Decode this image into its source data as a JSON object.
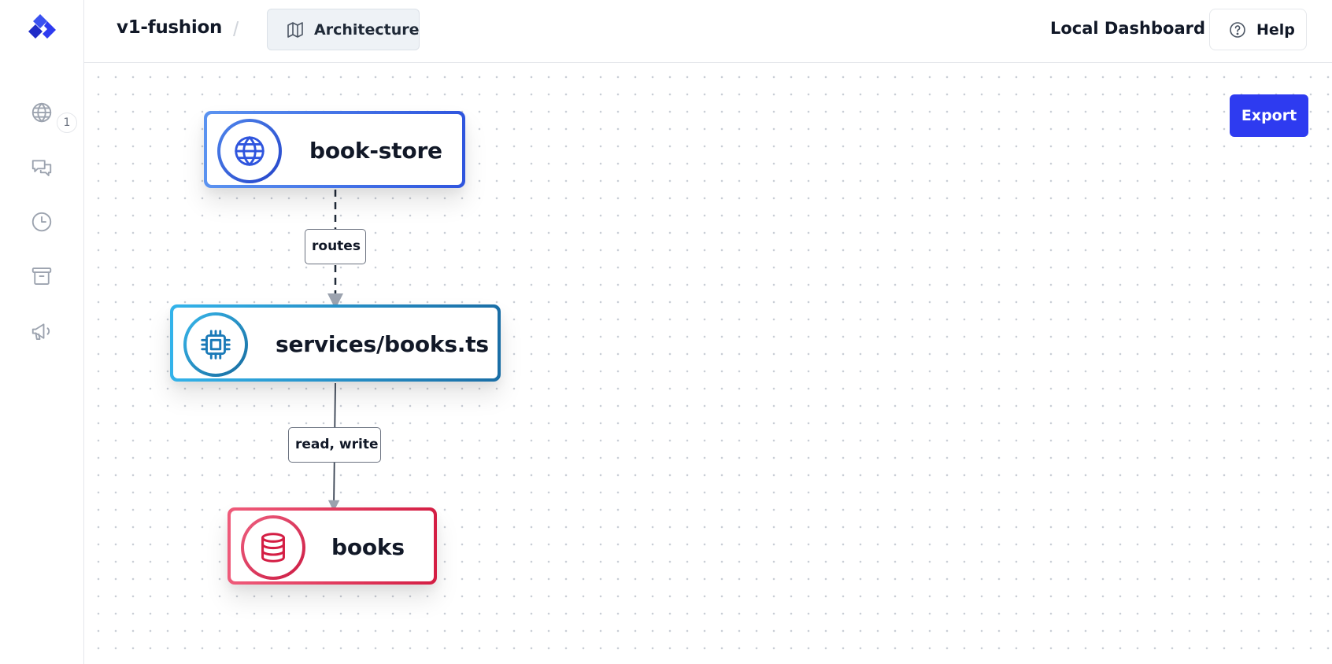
{
  "app": {
    "project_name": "v1-fushion",
    "breadcrumb_separator": "/",
    "current_view": "Architecture"
  },
  "sidebar": {
    "items": [
      {
        "name": "globe-icon",
        "badge": "1"
      },
      {
        "name": "chat-icon"
      },
      {
        "name": "clock-icon"
      },
      {
        "name": "archive-icon"
      },
      {
        "name": "megaphone-icon"
      }
    ]
  },
  "header": {
    "dashboard_link": "Local Dashboard",
    "help_label": "Help"
  },
  "canvas": {
    "export_label": "Export",
    "nodes": [
      {
        "id": "book-store",
        "label": "book-store",
        "kind": "web-app",
        "icon": "globe-icon",
        "color": "#2f55de"
      },
      {
        "id": "books-service",
        "label": "services/books.ts",
        "kind": "service",
        "icon": "chip-icon",
        "color": "#1a6ea6"
      },
      {
        "id": "books-db",
        "label": "books",
        "kind": "database",
        "icon": "database-icon",
        "color": "#d41e44"
      }
    ],
    "edges": [
      {
        "from": "book-store",
        "to": "books-service",
        "label": "routes",
        "style": "dashed"
      },
      {
        "from": "books-service",
        "to": "books-db",
        "label": "read, write",
        "style": "solid"
      }
    ]
  },
  "colors": {
    "accent": "#2e3bf0",
    "border": "#e5e7eb",
    "text": "#111827",
    "muted_icon": "#9ca3af"
  }
}
